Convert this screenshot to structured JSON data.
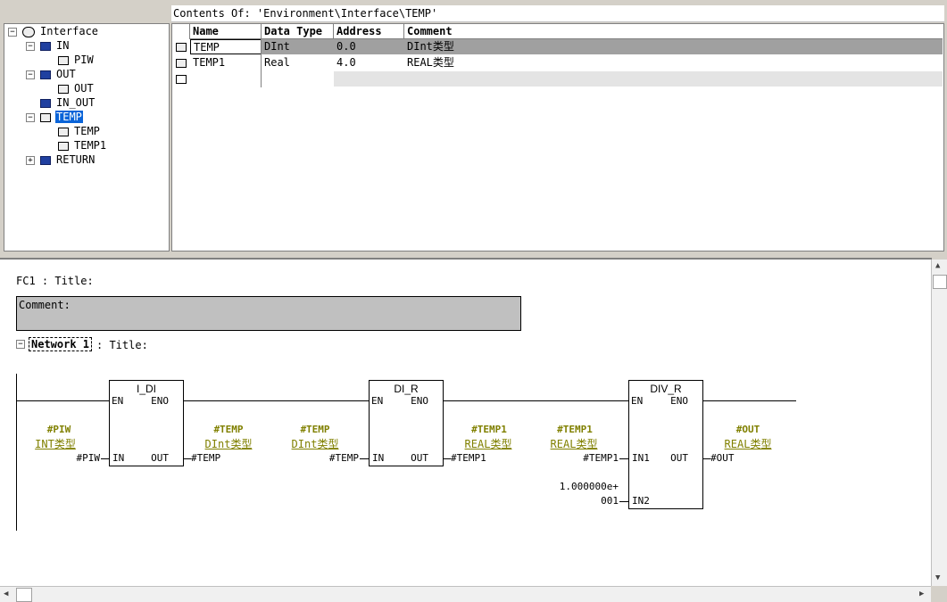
{
  "header": {
    "contents_of": "Contents Of: 'Environment\\Interface\\TEMP'"
  },
  "tree": {
    "root": "Interface",
    "in": "IN",
    "piw": "PIW",
    "out": "OUT",
    "out_child": "OUT",
    "in_out": "IN_OUT",
    "temp": "TEMP",
    "temp_child1": "TEMP",
    "temp_child2": "TEMP1",
    "return": "RETURN"
  },
  "table": {
    "columns": [
      "Name",
      "Data Type",
      "Address",
      "Comment"
    ],
    "rows": [
      {
        "name": "TEMP",
        "type": "DInt",
        "address": "0.0",
        "comment": "DInt类型"
      },
      {
        "name": "TEMP1",
        "type": "Real",
        "address": "4.0",
        "comment": "REAL类型"
      }
    ]
  },
  "code": {
    "block_title": "FC1 : Title:",
    "comment": "Comment:",
    "network": "Network 1",
    "network_title": ": Title:",
    "boxes": [
      {
        "name": "I_DI",
        "en": "EN",
        "eno": "ENO",
        "in": "IN",
        "out": "OUT"
      },
      {
        "name": "DI_R",
        "en": "EN",
        "eno": "ENO",
        "in": "IN",
        "out": "OUT"
      },
      {
        "name": "DIV_R",
        "en": "EN",
        "eno": "ENO",
        "in1": "IN1",
        "in2": "IN2",
        "out": "OUT"
      }
    ],
    "labels": {
      "piw_sym": "#PIW",
      "piw_type": "INT类型",
      "piw_op": "#PIW",
      "temp_sym_a": "#TEMP",
      "temp_type_a": "DInt类型",
      "temp_op_a": "#TEMP",
      "temp_sym_b": "#TEMP",
      "temp_type_b": "DInt类型",
      "temp_op_b": "#TEMP",
      "temp1_sym_a": "#TEMP1",
      "temp1_type_a": "REAL类型",
      "temp1_op_a": "#TEMP1",
      "temp1_sym_b": "#TEMP1",
      "temp1_type_b": "REAL类型",
      "temp1_op_b": "#TEMP1",
      "out_sym": "#OUT",
      "out_type": "REAL类型",
      "out_op": "#OUT",
      "const_a": "1.000000e+",
      "const_b": "001"
    }
  }
}
